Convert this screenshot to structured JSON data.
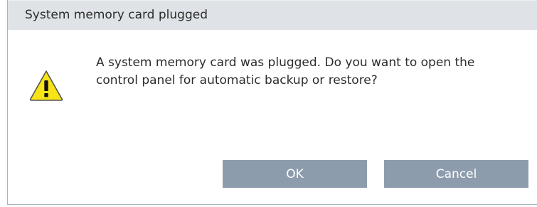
{
  "dialog": {
    "title": "System memory card plugged",
    "message": "A system memory card was plugged. Do you want to open the control panel for automatic backup or restore?",
    "icon": "warning-icon",
    "buttons": {
      "ok_label": "OK",
      "cancel_label": "Cancel"
    }
  },
  "colors": {
    "title_bar": "#dfe3e7",
    "button_bg": "#8d9cad",
    "button_text": "#ffffff",
    "warning_fill": "#f7e417",
    "text": "#2c2c2c"
  }
}
